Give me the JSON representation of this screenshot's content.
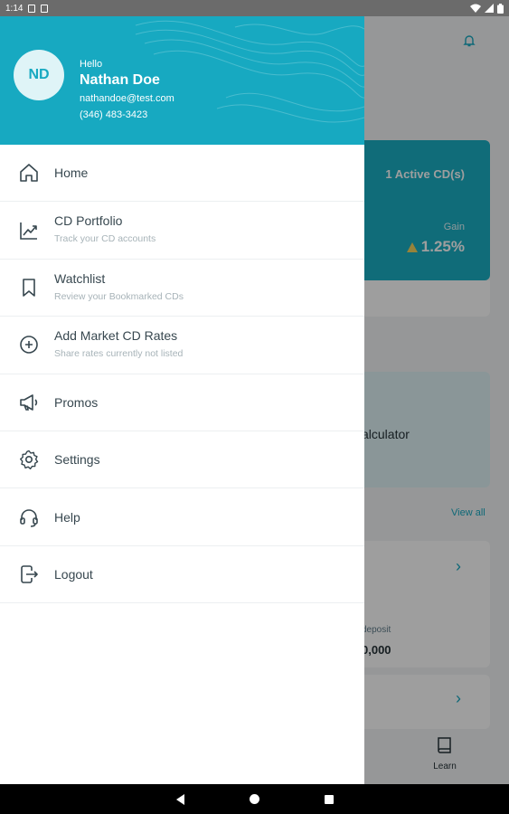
{
  "status_bar": {
    "time": "1:14"
  },
  "drawer": {
    "header": {
      "avatar_initials": "ND",
      "greeting": "Hello",
      "name": "Nathan Doe",
      "email": "nathandoe@test.com",
      "phone": "(346) 483-3423"
    },
    "menu": [
      {
        "label": "Home",
        "icon": "home-icon"
      },
      {
        "label": "CD Portfolio",
        "subtitle": "Track your CD accounts",
        "icon": "chart-line-icon"
      },
      {
        "label": "Watchlist",
        "subtitle": "Review your Bookmarked CDs",
        "icon": "bookmark-icon"
      },
      {
        "label": "Add Market CD Rates",
        "subtitle": "Share rates currently not listed",
        "icon": "add-circle-icon"
      },
      {
        "label": "Promos",
        "icon": "megaphone-icon"
      },
      {
        "label": "Settings",
        "icon": "gear-icon"
      },
      {
        "label": "Help",
        "icon": "headset-icon"
      },
      {
        "label": "Logout",
        "icon": "logout-icon"
      }
    ]
  },
  "background": {
    "active_cds": "1 Active CD(s)",
    "gain_label": "Gain",
    "gain_value": "1.25%",
    "calculator_label": "alculator",
    "view_all": "View all",
    "deposit_label": "deposit",
    "deposit_value": "0,000",
    "learn_label": "Learn"
  },
  "colors": {
    "brand": "#17a9c1",
    "gain_up": "#f4d35e"
  }
}
